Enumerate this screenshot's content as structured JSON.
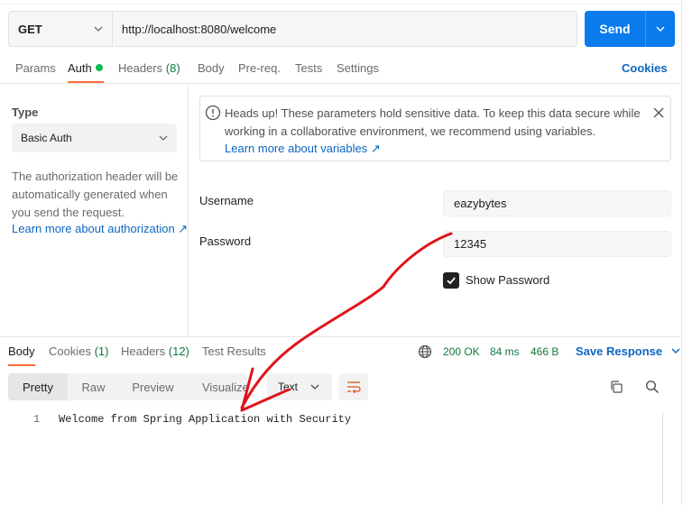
{
  "request": {
    "method": "GET",
    "url": "http://localhost:8080/welcome",
    "send_label": "Send"
  },
  "request_tabs": [
    {
      "label": "Params",
      "active": false
    },
    {
      "label": "Auth",
      "active": true,
      "indicator": "dot"
    },
    {
      "label": "Headers",
      "count": "(8)",
      "active": false
    },
    {
      "label": "Body",
      "active": false
    },
    {
      "label": "Pre-req.",
      "active": false
    },
    {
      "label": "Tests",
      "active": false
    },
    {
      "label": "Settings",
      "active": false
    }
  ],
  "cookies_link": "Cookies",
  "auth": {
    "type_label": "Type",
    "type_value": "Basic Auth",
    "description": "The authorization header will be automatically generated when you send the request.",
    "learn_link": "Learn more about authorization ↗"
  },
  "alert": {
    "text": "Heads up! These parameters hold sensitive data. To keep this data secure while working in a collaborative environment, we recommend using variables.",
    "link": "Learn more about variables ↗"
  },
  "fields": {
    "username_label": "Username",
    "username_value": "eazybytes",
    "password_label": "Password",
    "password_value": "12345",
    "show_password_label": "Show Password",
    "show_password_checked": true
  },
  "response_tabs": [
    {
      "label": "Body",
      "active": true
    },
    {
      "label": "Cookies",
      "count": "(1)",
      "active": false
    },
    {
      "label": "Headers",
      "count": "(12)",
      "active": false
    },
    {
      "label": "Test Results",
      "active": false
    }
  ],
  "status": {
    "code": "200 OK",
    "time": "84 ms",
    "size": "466 B",
    "save_label": "Save Response"
  },
  "view_modes": [
    {
      "label": "Pretty",
      "active": true
    },
    {
      "label": "Raw",
      "active": false
    },
    {
      "label": "Preview",
      "active": false
    },
    {
      "label": "Visualize",
      "active": false
    }
  ],
  "format_value": "Text",
  "response_body": {
    "line_number": "1",
    "content": "Welcome from Spring Application with Security"
  },
  "colors": {
    "accent": "#097bed",
    "tab_active": "#ff6c37",
    "status_ok": "#0d7a3f",
    "link": "#0d66c2",
    "annotation": "#e0141b"
  },
  "icons": [
    "chevron-down-icon",
    "info-icon",
    "close-icon",
    "external-link-icon",
    "checkmark-icon",
    "globe-icon",
    "wrap-lines-icon",
    "copy-icon",
    "search-icon"
  ]
}
